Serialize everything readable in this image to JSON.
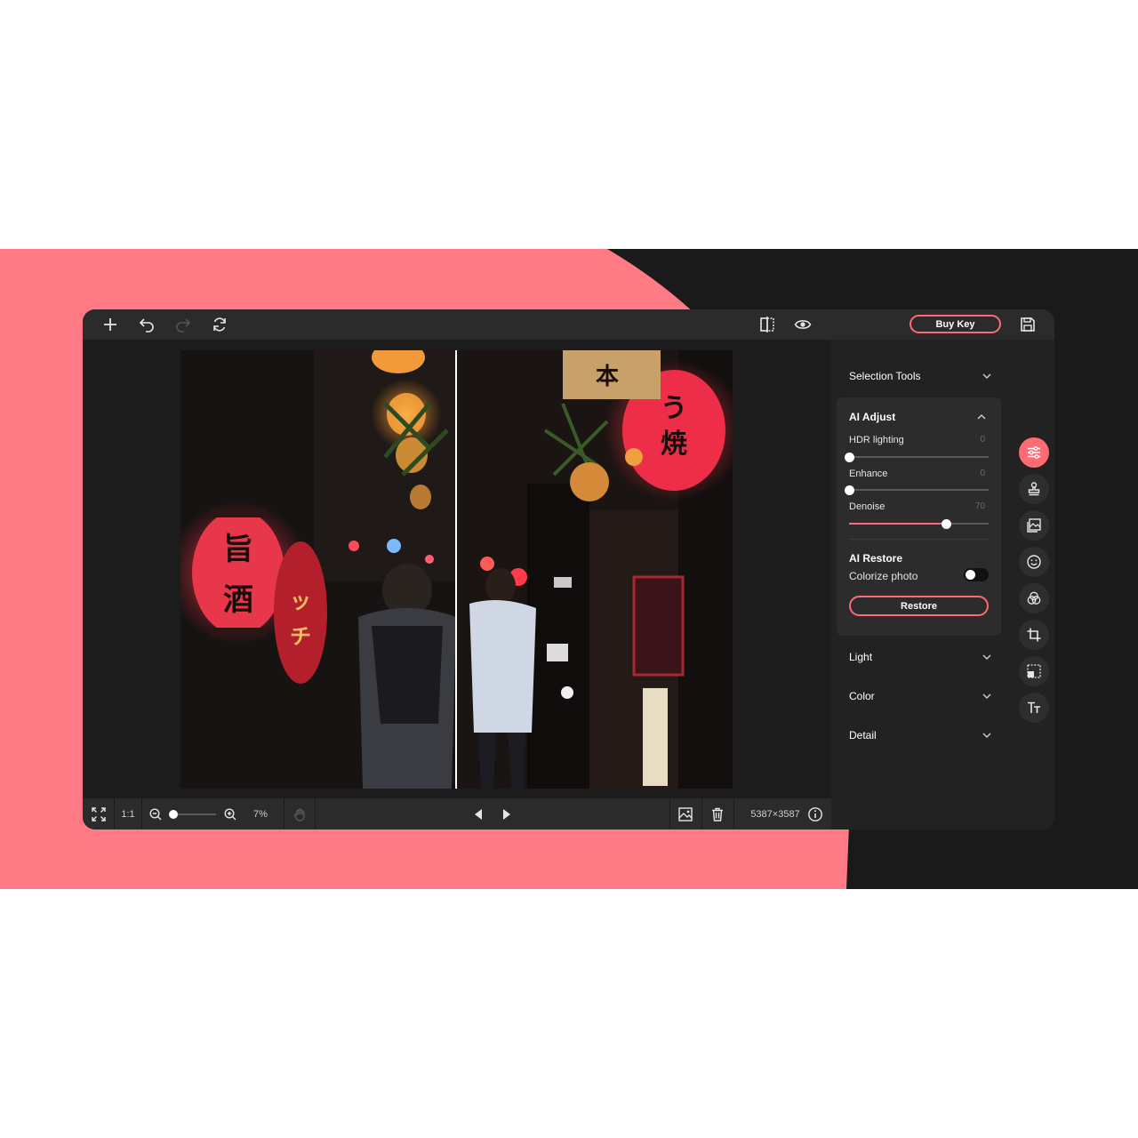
{
  "theme": {
    "accent": "#ff6b73",
    "panel": "#222222",
    "bar": "#2b2b2b",
    "pink_bg": "#ff7a85",
    "dark_bg": "#1a1a1a"
  },
  "toolbar": {
    "icons": [
      "plus-icon",
      "undo-icon",
      "redo-icon",
      "refresh-icon",
      "compare-icon",
      "eye-icon",
      "save-icon"
    ],
    "buy_key_label": "Buy Key"
  },
  "bottom": {
    "ratio_label": "1:1",
    "zoom_label": "7%",
    "zoom_value": 0.0,
    "dimensions": "5387×3587"
  },
  "panel": {
    "selection_tools": "Selection Tools",
    "ai_adjust": {
      "title": "AI Adjust",
      "sliders": [
        {
          "label": "HDR lighting",
          "value": "0",
          "fraction": 0.0
        },
        {
          "label": "Enhance",
          "value": "0",
          "fraction": 0.0
        },
        {
          "label": "Denoise",
          "value": "70",
          "fraction": 0.7
        }
      ]
    },
    "ai_restore": {
      "title": "AI Restore",
      "colorize_label": "Colorize photo",
      "colorize_on": false,
      "restore_label": "Restore"
    },
    "light": "Light",
    "color": "Color",
    "detail": "Detail"
  },
  "sidebar": {
    "icons": [
      "adjust-sliders-icon",
      "stamp-icon",
      "image-icon",
      "face-icon",
      "color-circles-icon",
      "crop-icon",
      "resize-icon",
      "text-icon"
    ],
    "active_index": 0
  }
}
